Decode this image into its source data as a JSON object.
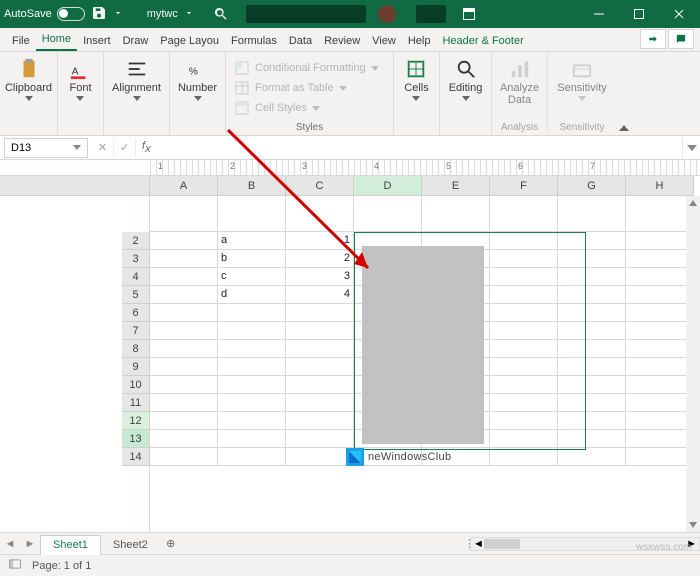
{
  "titlebar": {
    "autosave": "AutoSave",
    "doc": "mytwc"
  },
  "tabs": {
    "file": "File",
    "home": "Home",
    "insert": "Insert",
    "draw": "Draw",
    "page": "Page Layou",
    "formulas": "Formulas",
    "data": "Data",
    "review": "Review",
    "view": "View",
    "help": "Help",
    "hf": "Header & Footer"
  },
  "ribbon": {
    "clipboard": "Clipboard",
    "font": "Font",
    "alignment": "Alignment",
    "number": "Number",
    "styles": {
      "label": "Styles",
      "cf": "Conditional Formatting",
      "fat": "Format as Table",
      "cs": "Cell Styles"
    },
    "cells": "Cells",
    "editing": "Editing",
    "analyze": {
      "l1": "Analyze",
      "l2": "Data",
      "group": "Analysis"
    },
    "sensitivity": {
      "l1": "Sensitivity",
      "group": "Sensitivity"
    }
  },
  "namebox": "D13",
  "ruler_labels": [
    "1",
    "2",
    "3",
    "4",
    "5",
    "6",
    "7"
  ],
  "cols": [
    "A",
    "B",
    "C",
    "D",
    "E",
    "F",
    "G",
    "H"
  ],
  "rows": [
    "2",
    "3",
    "4",
    "5",
    "6",
    "7",
    "8",
    "9",
    "10",
    "11",
    "12",
    "13",
    "14"
  ],
  "cells": {
    "B2": "a",
    "C2": "1",
    "B3": "b",
    "C3": "2",
    "B4": "c",
    "C4": "3",
    "B5": "d",
    "C5": "4"
  },
  "brand": "neWindowsClub",
  "sheets": {
    "s1": "Sheet1",
    "s2": "Sheet2"
  },
  "status": {
    "page": "Page: 1 of 1"
  },
  "wm": "wsxwss.com"
}
